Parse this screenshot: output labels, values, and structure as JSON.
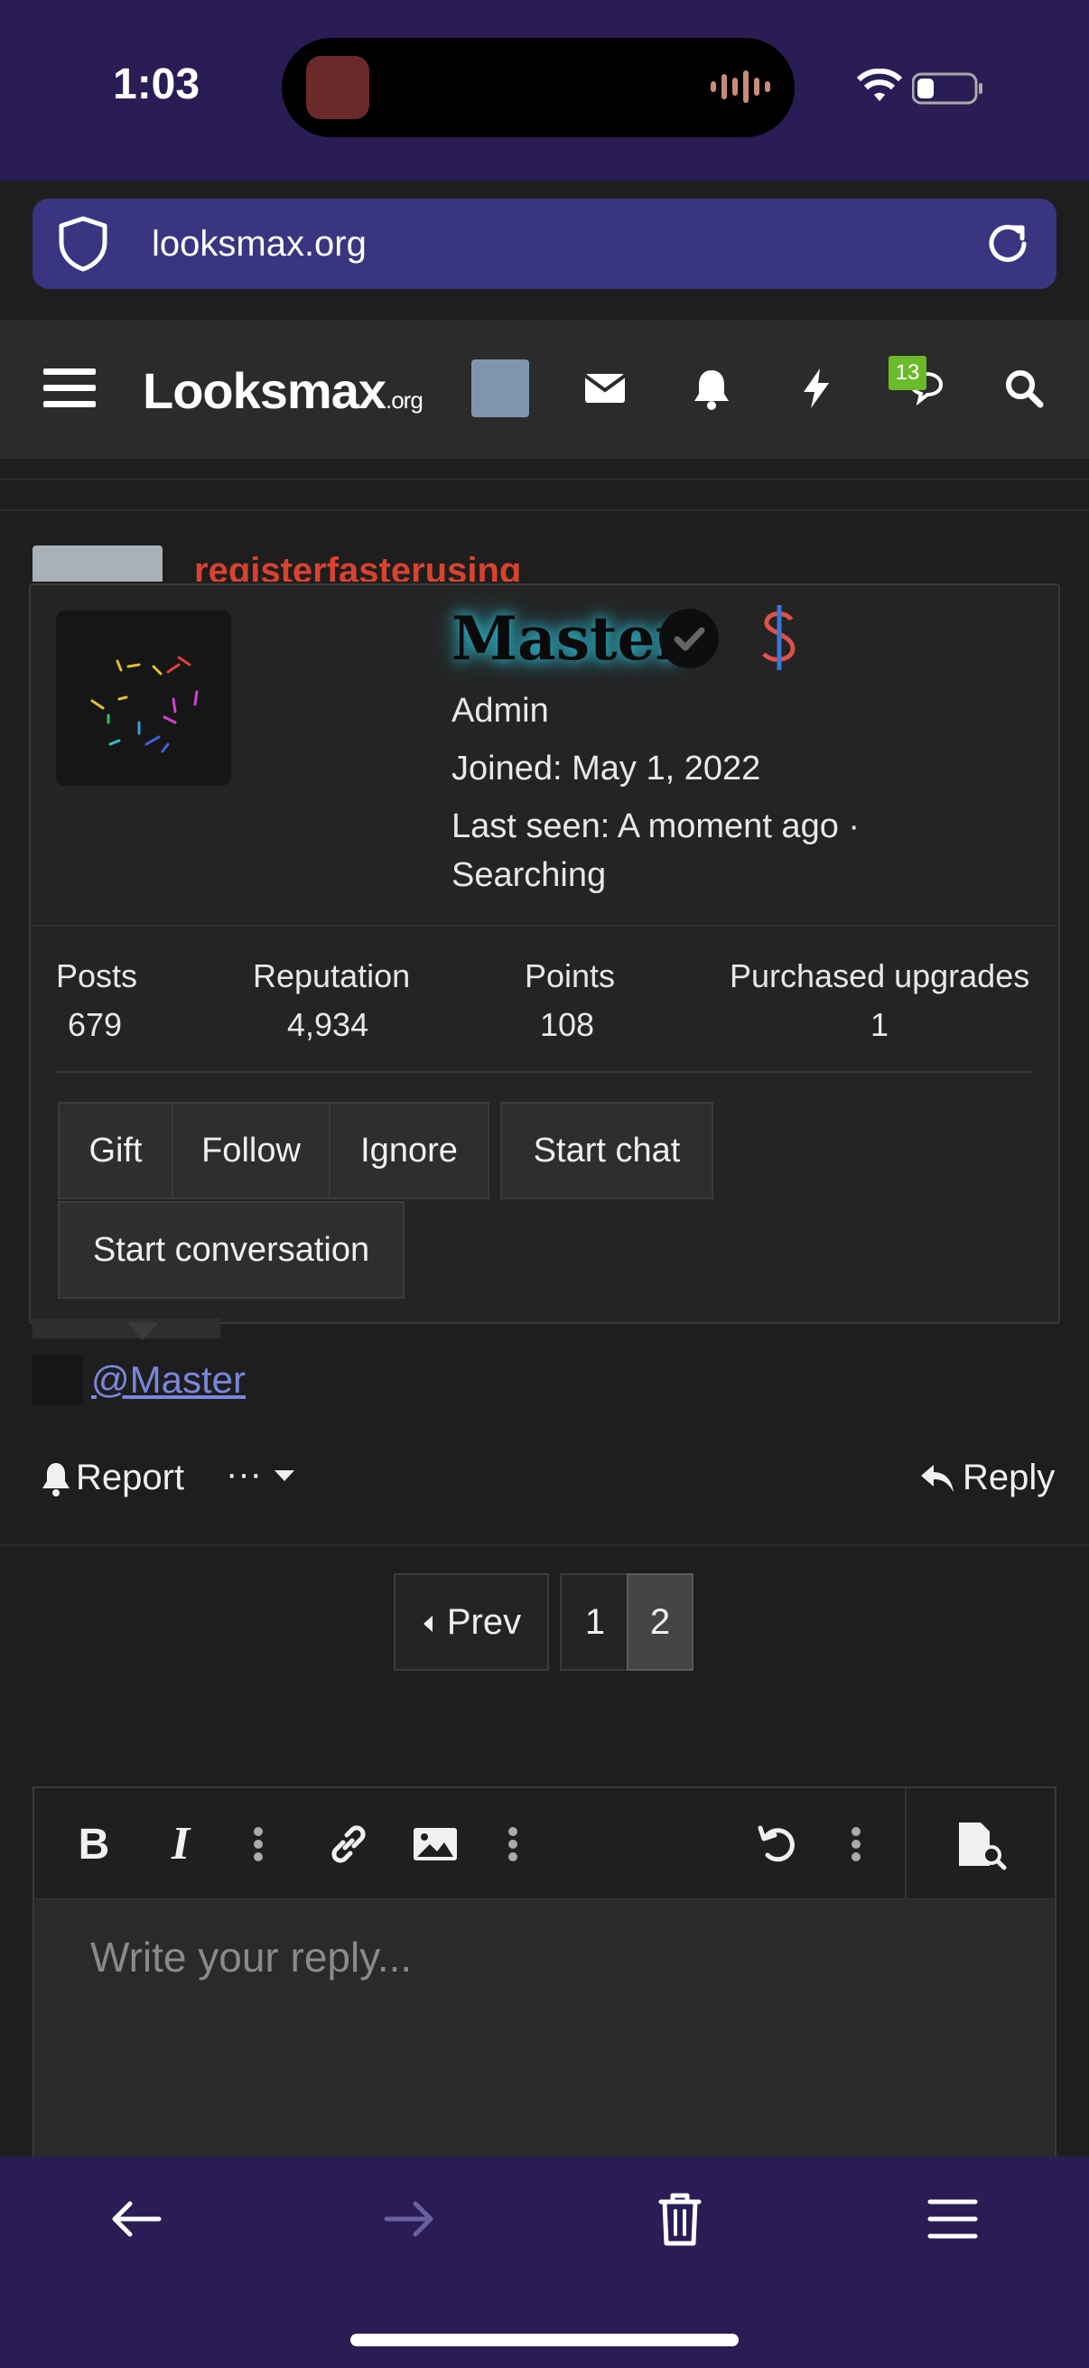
{
  "status": {
    "time": "1:03"
  },
  "browser": {
    "url": "looksmax.org"
  },
  "site": {
    "logo_main": "Looksmax",
    "logo_suffix": ".org",
    "chat_badge": "13"
  },
  "post": {
    "poster_name": "registerfasterusing"
  },
  "profile_card": {
    "name": "Master",
    "role": "Admin",
    "joined": "Joined: May 1, 2022",
    "last_seen_line1": "Last seen: A moment ago ·",
    "last_seen_line2": "Searching",
    "stats": [
      {
        "label": "Posts",
        "value": "679"
      },
      {
        "label": "Reputation",
        "value": "4,934"
      },
      {
        "label": "Points",
        "value": "108"
      },
      {
        "label": "Purchased upgrades",
        "value": "1"
      }
    ],
    "buttons": {
      "gift": "Gift",
      "follow": "Follow",
      "ignore": "Ignore",
      "start_chat": "Start chat",
      "start_conversation": "Start conversation"
    }
  },
  "mention": "@Master",
  "actions": {
    "report": "Report",
    "more": "···",
    "reply": "Reply"
  },
  "pagination": {
    "prev": "Prev",
    "pages": [
      "1",
      "2"
    ],
    "current": "2"
  },
  "editor": {
    "placeholder": "Write your reply..."
  },
  "colors": {
    "status_bg": "#2a1d55",
    "url_bg": "#3a3580",
    "name_glow": "#2bb3c9",
    "poster_name": "#d9422f",
    "mention_link": "#7b86dd",
    "badge_green": "#6aba2a"
  }
}
